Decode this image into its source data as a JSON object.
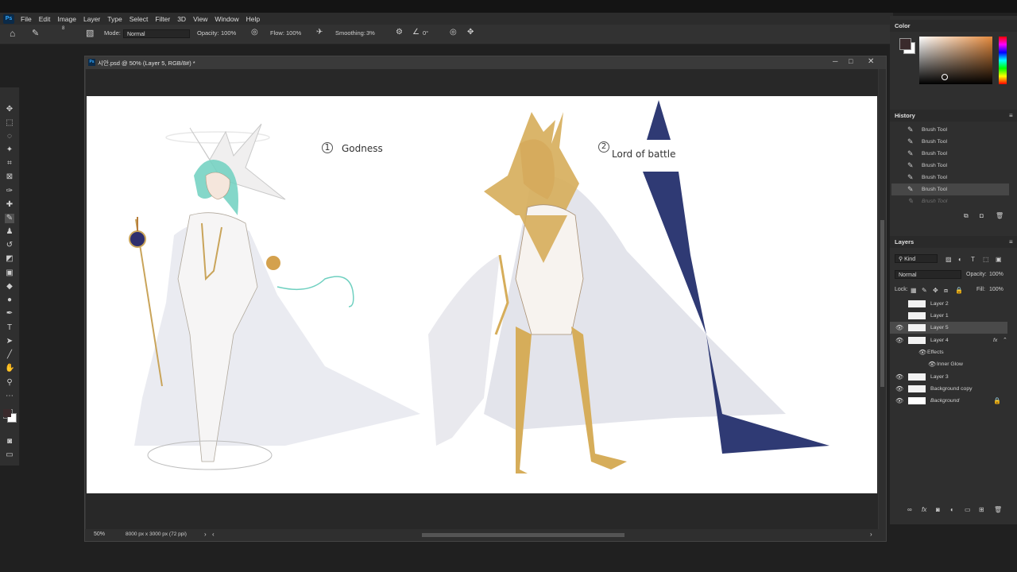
{
  "menu": [
    "File",
    "Edit",
    "Image",
    "Layer",
    "Type",
    "Select",
    "Filter",
    "3D",
    "View",
    "Window",
    "Help"
  ],
  "app_badge": "Ps",
  "options": {
    "mode_label": "Mode:",
    "mode_value": "Normal",
    "opacity_label": "Opacity:",
    "opacity_value": "100%",
    "flow_label": "Flow:",
    "flow_value": "100%",
    "smoothing_label": "Smoothing:",
    "smoothing_value": "3%",
    "angle_value": "0°",
    "brush_size": "8"
  },
  "document": {
    "title": "시안.psd @ 50% (Layer 5, RGB/8#) *",
    "zoom": "50%",
    "size": "8000 px x 3000 px (72 ppi)",
    "labels": [
      {
        "num": "1",
        "text": "Godness"
      },
      {
        "num": "2",
        "text": "Lord of battle"
      }
    ]
  },
  "color_panel": {
    "title": "Color",
    "fg": "#3a2a2c",
    "bg": "#ffffff"
  },
  "history": {
    "title": "History",
    "items": [
      "Brush Tool",
      "Brush Tool",
      "Brush Tool",
      "Brush Tool",
      "Brush Tool",
      "Brush Tool",
      "Brush Tool"
    ]
  },
  "layers": {
    "title": "Layers",
    "kind_label": "Kind",
    "blend_mode": "Normal",
    "opacity_label": "Opacity:",
    "opacity_value": "100%",
    "lock_label": "Lock:",
    "fill_label": "Fill:",
    "fill_value": "100%",
    "fx": "fx",
    "effects_label": "Effects",
    "inner_glow": "Inner Glow",
    "items": [
      "Layer 2",
      "Layer 1",
      "Layer 5",
      "Layer 4",
      "Layer 3",
      "Background copy",
      "Background"
    ]
  }
}
